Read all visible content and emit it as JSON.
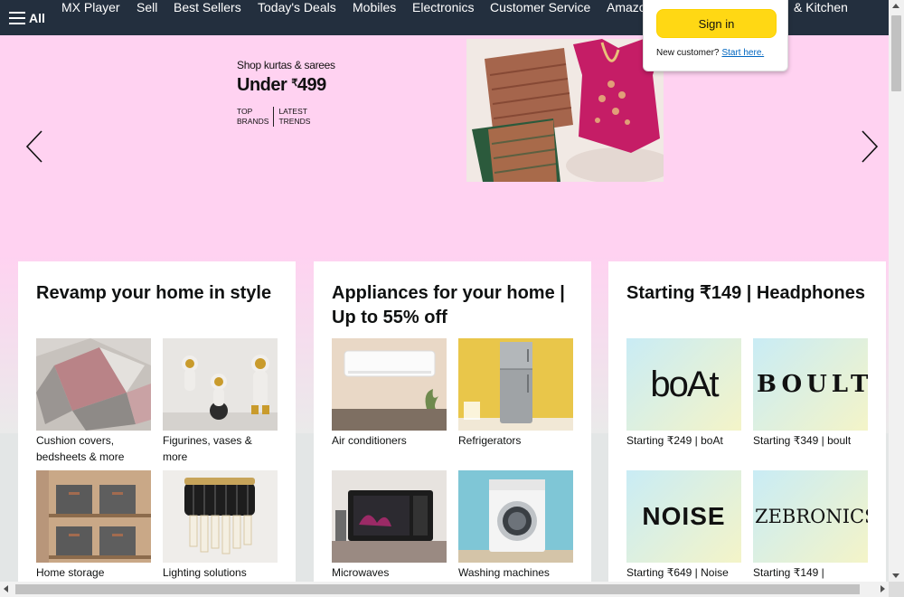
{
  "nav": {
    "all_label": "All",
    "links": [
      "MX Player",
      "Sell",
      "Best Sellers",
      "Today's Deals",
      "Mobiles",
      "Electronics",
      "Customer Service",
      "Amazo",
      "& Kitchen"
    ]
  },
  "hero": {
    "subtitle": "Shop kurtas & sarees",
    "price_prefix": "Under ",
    "price_currency": "₹",
    "price_value": "499",
    "tag1_line1": "TOP",
    "tag1_line2": "BRANDS",
    "tag2_line1": "LATEST",
    "tag2_line2": "TRENDS",
    "background": "#ffd2f1"
  },
  "signin": {
    "button_label": "Sign in",
    "new_customer": "New customer?",
    "start_here": "Start here."
  },
  "cards": [
    {
      "title": "Revamp your home in style",
      "tiles": [
        {
          "caption": "Cushion covers, bedsheets & more"
        },
        {
          "caption": "Figurines, vases & more"
        },
        {
          "caption": "Home storage"
        },
        {
          "caption": "Lighting solutions"
        }
      ]
    },
    {
      "title": "Appliances for your home | Up to 55% off",
      "tiles": [
        {
          "caption": "Air conditioners"
        },
        {
          "caption": "Refrigerators"
        },
        {
          "caption": "Microwaves"
        },
        {
          "caption": "Washing machines"
        }
      ]
    },
    {
      "title": "Starting ₹149 | Headphones",
      "tiles": [
        {
          "caption": "Starting ₹249 | boAt",
          "brand": "boAt"
        },
        {
          "caption": "Starting ₹349 | boult",
          "brand": "BOULT"
        },
        {
          "caption": "Starting ₹649 | Noise",
          "brand": "NOISE"
        },
        {
          "caption": "Starting ₹149 |",
          "brand": "ZEBRONICS"
        }
      ]
    }
  ],
  "colors": {
    "nav_bg": "#232f3e",
    "signin_button": "#ffd814",
    "link": "#0066c0"
  }
}
